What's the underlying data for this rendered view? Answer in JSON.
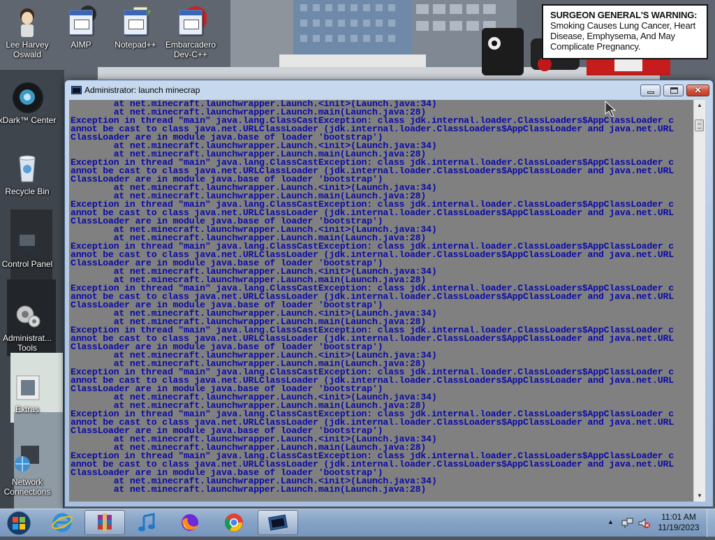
{
  "desktop": {
    "icons": [
      {
        "label": "Lee Harvey Oswald"
      },
      {
        "label": "AIMP"
      },
      {
        "label": "Notepad++"
      },
      {
        "label": "Embarcadero Dev-C++"
      },
      {
        "label": "xDark™ Center"
      },
      {
        "label": "Recycle Bin"
      },
      {
        "label": "Control Panel"
      },
      {
        "label": "Administrat... Tools"
      },
      {
        "label": "Extras"
      },
      {
        "label": "Network Connections"
      }
    ],
    "warning": {
      "heading": "SURGEON GENERAL'S WARNING:",
      "body": "Smoking Causes Lung Cancer, Heart Disease, Emphysema, And May Complicate Pregnancy."
    }
  },
  "window": {
    "title": "Administrator:  launch minecrap",
    "console_text_color": "#0a0aa8",
    "console_bg_color": "#808080",
    "console_lines": [
      "        at net.minecraft.launchwrapper.Launch.<init>(Launch.java:34)",
      "        at net.minecraft.launchwrapper.Launch.main(Launch.java:28)",
      "Exception in thread \"main\" java.lang.ClassCastException: class jdk.internal.loader.ClassLoaders$AppClassLoader c",
      "annot be cast to class java.net.URLClassLoader (jdk.internal.loader.ClassLoaders$AppClassLoader and java.net.URL",
      "ClassLoader are in module java.base of loader 'bootstrap')",
      "        at net.minecraft.launchwrapper.Launch.<init>(Launch.java:34)",
      "        at net.minecraft.launchwrapper.Launch.main(Launch.java:28)",
      "Exception in thread \"main\" java.lang.ClassCastException: class jdk.internal.loader.ClassLoaders$AppClassLoader c",
      "annot be cast to class java.net.URLClassLoader (jdk.internal.loader.ClassLoaders$AppClassLoader and java.net.URL",
      "ClassLoader are in module java.base of loader 'bootstrap')",
      "        at net.minecraft.launchwrapper.Launch.<init>(Launch.java:34)",
      "        at net.minecraft.launchwrapper.Launch.main(Launch.java:28)",
      "Exception in thread \"main\" java.lang.ClassCastException: class jdk.internal.loader.ClassLoaders$AppClassLoader c",
      "annot be cast to class java.net.URLClassLoader (jdk.internal.loader.ClassLoaders$AppClassLoader and java.net.URL",
      "ClassLoader are in module java.base of loader 'bootstrap')",
      "        at net.minecraft.launchwrapper.Launch.<init>(Launch.java:34)",
      "        at net.minecraft.launchwrapper.Launch.main(Launch.java:28)",
      "Exception in thread \"main\" java.lang.ClassCastException: class jdk.internal.loader.ClassLoaders$AppClassLoader c",
      "annot be cast to class java.net.URLClassLoader (jdk.internal.loader.ClassLoaders$AppClassLoader and java.net.URL",
      "ClassLoader are in module java.base of loader 'bootstrap')",
      "        at net.minecraft.launchwrapper.Launch.<init>(Launch.java:34)",
      "        at net.minecraft.launchwrapper.Launch.main(Launch.java:28)",
      "Exception in thread \"main\" java.lang.ClassCastException: class jdk.internal.loader.ClassLoaders$AppClassLoader c",
      "annot be cast to class java.net.URLClassLoader (jdk.internal.loader.ClassLoaders$AppClassLoader and java.net.URL",
      "ClassLoader are in module java.base of loader 'bootstrap')",
      "        at net.minecraft.launchwrapper.Launch.<init>(Launch.java:34)",
      "        at net.minecraft.launchwrapper.Launch.main(Launch.java:28)",
      "Exception in thread \"main\" java.lang.ClassCastException: class jdk.internal.loader.ClassLoaders$AppClassLoader c",
      "annot be cast to class java.net.URLClassLoader (jdk.internal.loader.ClassLoaders$AppClassLoader and java.net.URL",
      "ClassLoader are in module java.base of loader 'bootstrap')",
      "        at net.minecraft.launchwrapper.Launch.<init>(Launch.java:34)",
      "        at net.minecraft.launchwrapper.Launch.main(Launch.java:28)",
      "Exception in thread \"main\" java.lang.ClassCastException: class jdk.internal.loader.ClassLoaders$AppClassLoader c",
      "annot be cast to class java.net.URLClassLoader (jdk.internal.loader.ClassLoaders$AppClassLoader and java.net.URL",
      "ClassLoader are in module java.base of loader 'bootstrap')",
      "        at net.minecraft.launchwrapper.Launch.<init>(Launch.java:34)",
      "        at net.minecraft.launchwrapper.Launch.main(Launch.java:28)",
      "Exception in thread \"main\" java.lang.ClassCastException: class jdk.internal.loader.ClassLoaders$AppClassLoader c",
      "annot be cast to class java.net.URLClassLoader (jdk.internal.loader.ClassLoaders$AppClassLoader and java.net.URL",
      "ClassLoader are in module java.base of loader 'bootstrap')",
      "        at net.minecraft.launchwrapper.Launch.<init>(Launch.java:34)",
      "        at net.minecraft.launchwrapper.Launch.main(Launch.java:28)",
      "Exception in thread \"main\" java.lang.ClassCastException: class jdk.internal.loader.ClassLoaders$AppClassLoader c",
      "annot be cast to class java.net.URLClassLoader (jdk.internal.loader.ClassLoaders$AppClassLoader and java.net.URL",
      "ClassLoader are in module java.base of loader 'bootstrap')",
      "        at net.minecraft.launchwrapper.Launch.<init>(Launch.java:34)",
      "        at net.minecraft.launchwrapper.Launch.main(Launch.java:28)"
    ]
  },
  "taskbar": {
    "pinned": [
      {
        "icon": "internet-explorer-icon"
      },
      {
        "icon": "winrar-icon"
      },
      {
        "icon": "music-note-icon"
      },
      {
        "icon": "firefox-icon"
      },
      {
        "icon": "chrome-icon"
      },
      {
        "icon": "console-window-icon"
      }
    ],
    "clock": {
      "time": "11:01 AM",
      "date": "11/19/2023"
    }
  }
}
